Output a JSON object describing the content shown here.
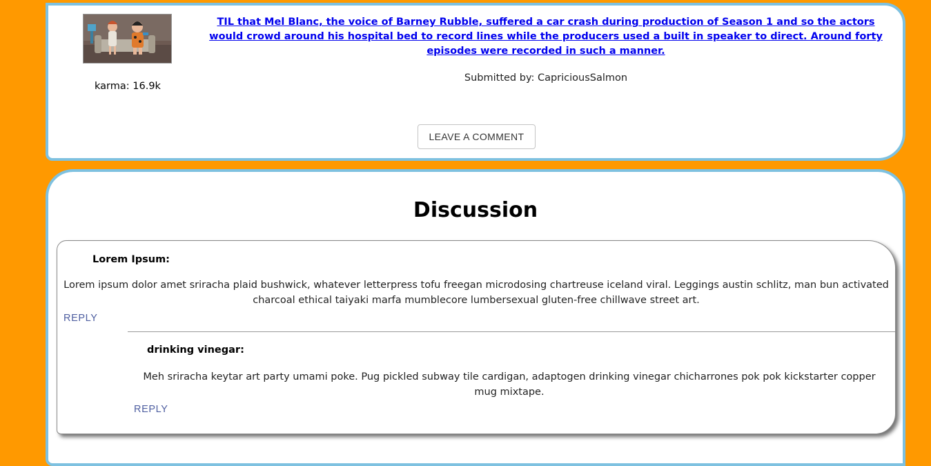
{
  "post": {
    "thumbnail_icon": "cartoon-thumbnail",
    "karma": "karma: 16.9k",
    "title": "TIL that Mel Blanc, the voice of Barney Rubble, suffered a car crash during production of Season 1 and so the actors would crowd around his hospital bed to record lines while the producers used a built in speaker to direct. Around forty episodes were recorded in such a manner.",
    "submitted_by": "Submitted by: CapriciousSalmon",
    "comment_button": "LEAVE A COMMENT"
  },
  "discussion": {
    "title": "Discussion",
    "comments": [
      {
        "author": "Lorem Ipsum:",
        "text": "Lorem ipsum dolor amet sriracha plaid bushwick, whatever letterpress tofu freegan microdosing chartreuse iceland viral. Leggings austin schlitz, man bun activated charcoal ethical taiyaki marfa mumblecore lumbersexual gluten-free chillwave street art.",
        "reply_label": "REPLY"
      },
      {
        "author": "drinking vinegar:",
        "text": "Meh sriracha keytar art party umami poke. Pug pickled subway tile cardigan, adaptogen drinking vinegar chicharrones pok pok kickstarter copper mug mixtape.",
        "reply_label": "REPLY"
      }
    ]
  },
  "colors": {
    "page_background": "#ff9900",
    "card_border": "#7ec1e0",
    "link": "#0000ee",
    "reply": "#4e5ea0"
  }
}
